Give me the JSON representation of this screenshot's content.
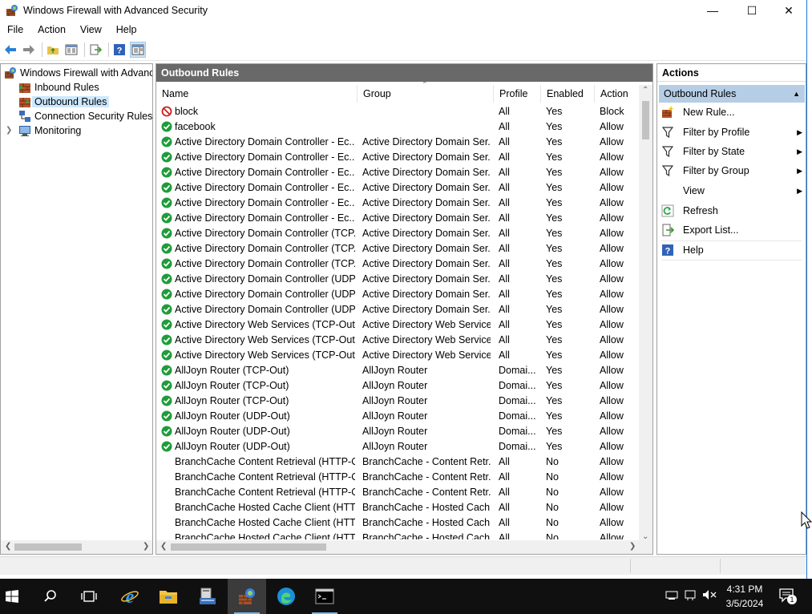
{
  "window": {
    "title": "Windows Firewall with Advanced Security",
    "minimize": "—",
    "maximize": "☐",
    "close": "✕"
  },
  "menu": [
    "File",
    "Action",
    "View",
    "Help"
  ],
  "tree": {
    "root": "Windows Firewall with Advanced Security",
    "items": [
      "Inbound Rules",
      "Outbound Rules",
      "Connection Security Rules",
      "Monitoring"
    ],
    "selected": "Outbound Rules"
  },
  "middle": {
    "header": "Outbound Rules",
    "columns": {
      "name": "Name",
      "group": "Group",
      "profile": "Profile",
      "enabled": "Enabled",
      "action": "Action"
    },
    "rows": [
      {
        "icon": "block",
        "name": "block",
        "group": "",
        "profile": "All",
        "enabled": "Yes",
        "action": "Block"
      },
      {
        "icon": "allow",
        "name": "facebook",
        "group": "",
        "profile": "All",
        "enabled": "Yes",
        "action": "Allow"
      },
      {
        "icon": "allow",
        "name": "Active Directory Domain Controller -  Ec...",
        "group": "Active Directory Domain Ser...",
        "profile": "All",
        "enabled": "Yes",
        "action": "Allow"
      },
      {
        "icon": "allow",
        "name": "Active Directory Domain Controller -  Ec...",
        "group": "Active Directory Domain Ser...",
        "profile": "All",
        "enabled": "Yes",
        "action": "Allow"
      },
      {
        "icon": "allow",
        "name": "Active Directory Domain Controller -  Ec...",
        "group": "Active Directory Domain Ser...",
        "profile": "All",
        "enabled": "Yes",
        "action": "Allow"
      },
      {
        "icon": "allow",
        "name": "Active Directory Domain Controller -  Ec...",
        "group": "Active Directory Domain Ser...",
        "profile": "All",
        "enabled": "Yes",
        "action": "Allow"
      },
      {
        "icon": "allow",
        "name": "Active Directory Domain Controller -  Ec...",
        "group": "Active Directory Domain Ser...",
        "profile": "All",
        "enabled": "Yes",
        "action": "Allow"
      },
      {
        "icon": "allow",
        "name": "Active Directory Domain Controller -  Ec...",
        "group": "Active Directory Domain Ser...",
        "profile": "All",
        "enabled": "Yes",
        "action": "Allow"
      },
      {
        "icon": "allow",
        "name": "Active Directory Domain Controller (TCP...",
        "group": "Active Directory Domain Ser...",
        "profile": "All",
        "enabled": "Yes",
        "action": "Allow"
      },
      {
        "icon": "allow",
        "name": "Active Directory Domain Controller (TCP...",
        "group": "Active Directory Domain Ser...",
        "profile": "All",
        "enabled": "Yes",
        "action": "Allow"
      },
      {
        "icon": "allow",
        "name": "Active Directory Domain Controller (TCP...",
        "group": "Active Directory Domain Ser...",
        "profile": "All",
        "enabled": "Yes",
        "action": "Allow"
      },
      {
        "icon": "allow",
        "name": "Active Directory Domain Controller (UDP...",
        "group": "Active Directory Domain Ser...",
        "profile": "All",
        "enabled": "Yes",
        "action": "Allow"
      },
      {
        "icon": "allow",
        "name": "Active Directory Domain Controller (UDP...",
        "group": "Active Directory Domain Ser...",
        "profile": "All",
        "enabled": "Yes",
        "action": "Allow"
      },
      {
        "icon": "allow",
        "name": "Active Directory Domain Controller (UDP...",
        "group": "Active Directory Domain Ser...",
        "profile": "All",
        "enabled": "Yes",
        "action": "Allow"
      },
      {
        "icon": "allow",
        "name": "Active Directory Web Services (TCP-Out)",
        "group": "Active Directory Web Services",
        "profile": "All",
        "enabled": "Yes",
        "action": "Allow"
      },
      {
        "icon": "allow",
        "name": "Active Directory Web Services (TCP-Out)",
        "group": "Active Directory Web Services",
        "profile": "All",
        "enabled": "Yes",
        "action": "Allow"
      },
      {
        "icon": "allow",
        "name": "Active Directory Web Services (TCP-Out)",
        "group": "Active Directory Web Services",
        "profile": "All",
        "enabled": "Yes",
        "action": "Allow"
      },
      {
        "icon": "allow",
        "name": "AllJoyn Router (TCP-Out)",
        "group": "AllJoyn Router",
        "profile": "Domai...",
        "enabled": "Yes",
        "action": "Allow"
      },
      {
        "icon": "allow",
        "name": "AllJoyn Router (TCP-Out)",
        "group": "AllJoyn Router",
        "profile": "Domai...",
        "enabled": "Yes",
        "action": "Allow"
      },
      {
        "icon": "allow",
        "name": "AllJoyn Router (TCP-Out)",
        "group": "AllJoyn Router",
        "profile": "Domai...",
        "enabled": "Yes",
        "action": "Allow"
      },
      {
        "icon": "allow",
        "name": "AllJoyn Router (UDP-Out)",
        "group": "AllJoyn Router",
        "profile": "Domai...",
        "enabled": "Yes",
        "action": "Allow"
      },
      {
        "icon": "allow",
        "name": "AllJoyn Router (UDP-Out)",
        "group": "AllJoyn Router",
        "profile": "Domai...",
        "enabled": "Yes",
        "action": "Allow"
      },
      {
        "icon": "allow",
        "name": "AllJoyn Router (UDP-Out)",
        "group": "AllJoyn Router",
        "profile": "Domai...",
        "enabled": "Yes",
        "action": "Allow"
      },
      {
        "icon": "none",
        "name": "BranchCache Content Retrieval (HTTP-O...",
        "group": "BranchCache - Content Retr...",
        "profile": "All",
        "enabled": "No",
        "action": "Allow"
      },
      {
        "icon": "none",
        "name": "BranchCache Content Retrieval (HTTP-O...",
        "group": "BranchCache - Content Retr...",
        "profile": "All",
        "enabled": "No",
        "action": "Allow"
      },
      {
        "icon": "none",
        "name": "BranchCache Content Retrieval (HTTP-O...",
        "group": "BranchCache - Content Retr...",
        "profile": "All",
        "enabled": "No",
        "action": "Allow"
      },
      {
        "icon": "none",
        "name": "BranchCache Hosted Cache Client (HTT...",
        "group": "BranchCache - Hosted Cach...",
        "profile": "All",
        "enabled": "No",
        "action": "Allow"
      },
      {
        "icon": "none",
        "name": "BranchCache Hosted Cache Client (HTT...",
        "group": "BranchCache - Hosted Cach...",
        "profile": "All",
        "enabled": "No",
        "action": "Allow"
      },
      {
        "icon": "none",
        "name": "BranchCache Hosted Cache Client (HTT...",
        "group": "BranchCache - Hosted Cach...",
        "profile": "All",
        "enabled": "No",
        "action": "Allow"
      }
    ]
  },
  "actions": {
    "title": "Actions",
    "section": "Outbound Rules",
    "items": [
      {
        "label": "New Rule...",
        "icon": "new-rule-icon",
        "submenu": false
      },
      {
        "label": "Filter by Profile",
        "icon": "filter-icon",
        "submenu": true
      },
      {
        "label": "Filter by State",
        "icon": "filter-icon",
        "submenu": true
      },
      {
        "label": "Filter by Group",
        "icon": "filter-icon",
        "submenu": true
      },
      {
        "label": "View",
        "icon": "none",
        "submenu": true
      },
      {
        "label": "Refresh",
        "icon": "refresh-icon",
        "submenu": false
      },
      {
        "label": "Export List...",
        "icon": "export-icon",
        "submenu": false
      },
      {
        "label": "Help",
        "icon": "help-icon",
        "submenu": false
      }
    ]
  },
  "taskbar": {
    "time": "4:31 PM",
    "date": "3/5/2024",
    "notification_count": "1"
  },
  "colors": {
    "header_bg": "#696969",
    "selection_bg": "#cce8ff",
    "action_section_bg": "#b6cde6",
    "allow_green": "#1f9c3a",
    "block_red": "#d01e1e",
    "taskbar_bg": "#101010"
  }
}
